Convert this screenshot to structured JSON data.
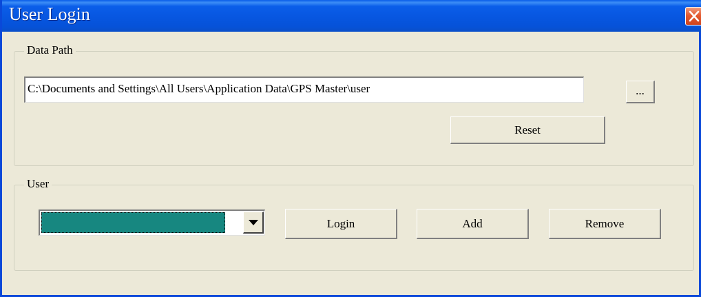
{
  "window": {
    "title": "User Login",
    "close_icon": "close-icon"
  },
  "data_path": {
    "group_label": "Data Path",
    "path_value": "C:\\Documents and Settings\\All Users\\Application Data\\GPS Master\\user",
    "browse_label": "...",
    "reset_label": "Reset"
  },
  "user": {
    "group_label": "User",
    "selected_user": "",
    "dropdown_icon": "chevron-down-icon",
    "login_label": "Login",
    "add_label": "Add",
    "remove_label": "Remove"
  },
  "colors": {
    "titlebar": "#0756e0",
    "window_bg": "#ece9d8",
    "selection": "#178780",
    "close_button": "#e45a31"
  }
}
